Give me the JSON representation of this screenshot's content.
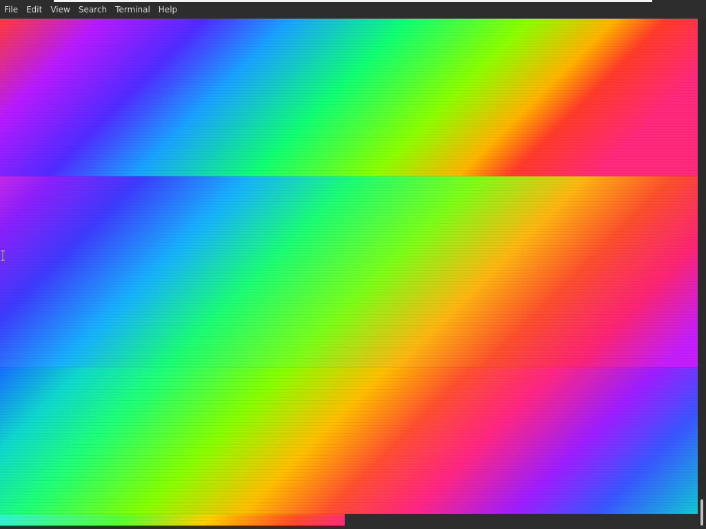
{
  "menu": {
    "items": [
      {
        "label": "File"
      },
      {
        "label": "Edit"
      },
      {
        "label": "View"
      },
      {
        "label": "Search"
      },
      {
        "label": "Terminal"
      },
      {
        "label": "Help"
      }
    ]
  },
  "colors": {
    "window_background": "#2d2d2d",
    "menu_text": "#d8d8d8",
    "scroll_thumb": "#bdbdbd",
    "title_strip": "#f4f4f4"
  },
  "icons": {
    "text_cursor": "i-beam-cursor-icon"
  }
}
